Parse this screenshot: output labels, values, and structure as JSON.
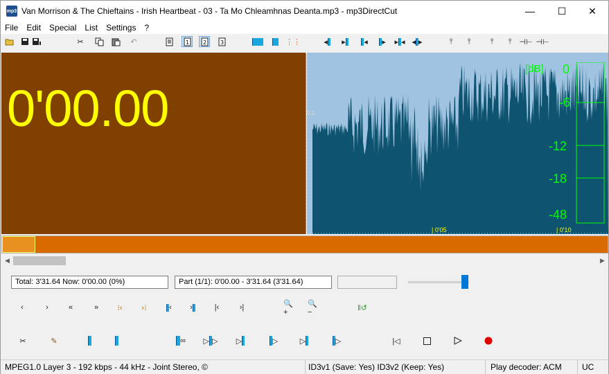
{
  "window": {
    "title": "Van Morrison & The Chieftains - Irish Heartbeat - 03 - Ta Mo Chleamhnas Deanta.mp3 - mp3DirectCut",
    "app_icon_text": "mp3",
    "minimize": "—",
    "maximize": "☐",
    "close": "✕"
  },
  "menu": [
    "File",
    "Edit",
    "Special",
    "List",
    "Settings",
    "?"
  ],
  "display": {
    "time": "0'00.00",
    "position_marker": "0.0",
    "ruler": [
      "| 0'05",
      "| 0'10"
    ],
    "db_unit": "[dB]",
    "db_scale": [
      "0",
      "-6",
      "-12",
      "-18",
      "-48"
    ]
  },
  "info": {
    "total_now": "Total: 3'31.64   Now: 0'00.00   (0%)",
    "part": "Part (1/1): 0'00.00 - 3'31.64 (3'31.64)",
    "extra": "",
    "volume_level": 0.93
  },
  "status": {
    "format": "MPEG1.0 Layer 3 - 192 kbps - 44 kHz - Joint Stereo, ©",
    "id3": "ID3v1 (Save: Yes)   ID3v2 (Keep: Yes)",
    "decoder": "Play decoder: ACM",
    "mode": "UC"
  },
  "colors": {
    "time_bg": "#7f4000",
    "time_fg": "#ffff00",
    "wave_bg": "#9fc3e0",
    "wave_fill": "#0e5470",
    "meter": "#00ff00",
    "timeline": "#d86a00"
  },
  "toolbar_icons": [
    "open-icon",
    "save-icon",
    "save-split-icon",
    "cut-icon",
    "copy-icon",
    "paste-icon",
    "undo-icon",
    "page-icon",
    "page-1-icon",
    "page-2-icon",
    "page-3-icon",
    "cue-icon",
    "marker-icon",
    "dotted-marker-icon",
    "move-left-icon",
    "move-right-icon",
    "cursor-to-left-icon",
    "cursor-to-right-icon",
    "expand-left-icon",
    "expand-right-icon",
    "fade-in-icon",
    "fade-out-icon",
    "fade-icon",
    "split-icon",
    "split-all-icon"
  ],
  "control_icons": [
    "step-back-icon",
    "step-forward-icon",
    "fast-back-icon",
    "fast-forward-icon",
    "prev-marker-icon",
    "next-marker-icon",
    "to-sel-start-icon",
    "to-sel-end-icon",
    "to-start-icon",
    "to-end-icon",
    "zoom-in-icon",
    "zoom-out-icon",
    "level-icon",
    "scissors-icon",
    "marker-pen-icon",
    "set-begin-icon",
    "set-end-icon",
    "play-loop-icon",
    "play-sel-icon",
    "play-to-begin-icon",
    "play-begin-icon",
    "play-end-icon",
    "play-after-icon",
    "rewind-icon",
    "stop-icon",
    "play-icon",
    "record-icon"
  ]
}
